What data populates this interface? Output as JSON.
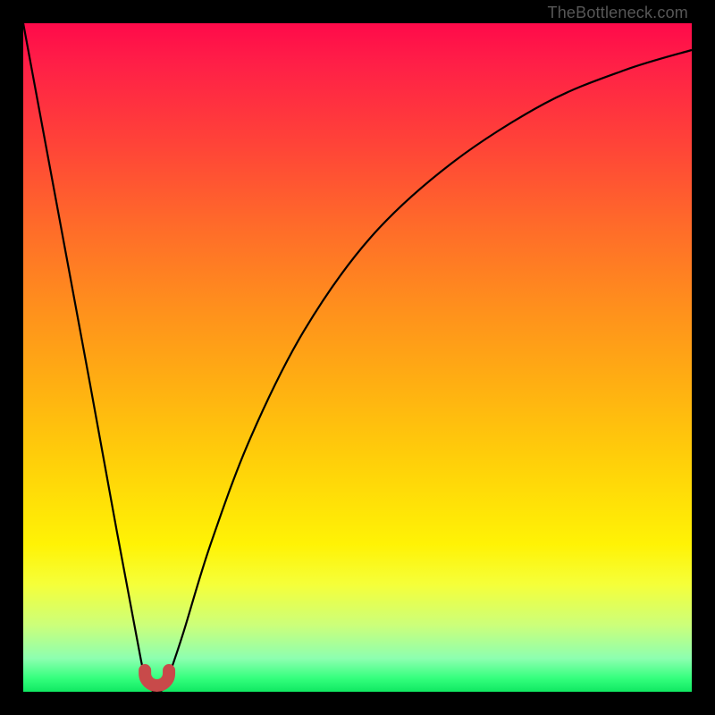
{
  "attribution": "TheBottleneck.com",
  "colors": {
    "black": "#000000",
    "curve_stroke": "#000000",
    "marker_stroke": "#c84a4a",
    "marker_fill": "none"
  },
  "chart_data": {
    "type": "line",
    "title": "",
    "xlabel": "",
    "ylabel": "",
    "xlim": [
      0,
      100
    ],
    "ylim": [
      0,
      100
    ],
    "grid": false,
    "series": [
      {
        "name": "bottleneck-curve",
        "x": [
          0,
          5,
          10,
          14,
          17,
          18,
          19,
          20,
          21,
          22,
          24,
          28,
          34,
          42,
          52,
          64,
          78,
          90,
          100
        ],
        "values": [
          100,
          73,
          46,
          24,
          8,
          3,
          0.5,
          0,
          0.5,
          3,
          9,
          22,
          38,
          54,
          68,
          79,
          88,
          93,
          96
        ]
      }
    ],
    "minimum_marker": {
      "x_range": [
        18.2,
        21.8
      ],
      "y_range": [
        0,
        3.2
      ]
    }
  }
}
